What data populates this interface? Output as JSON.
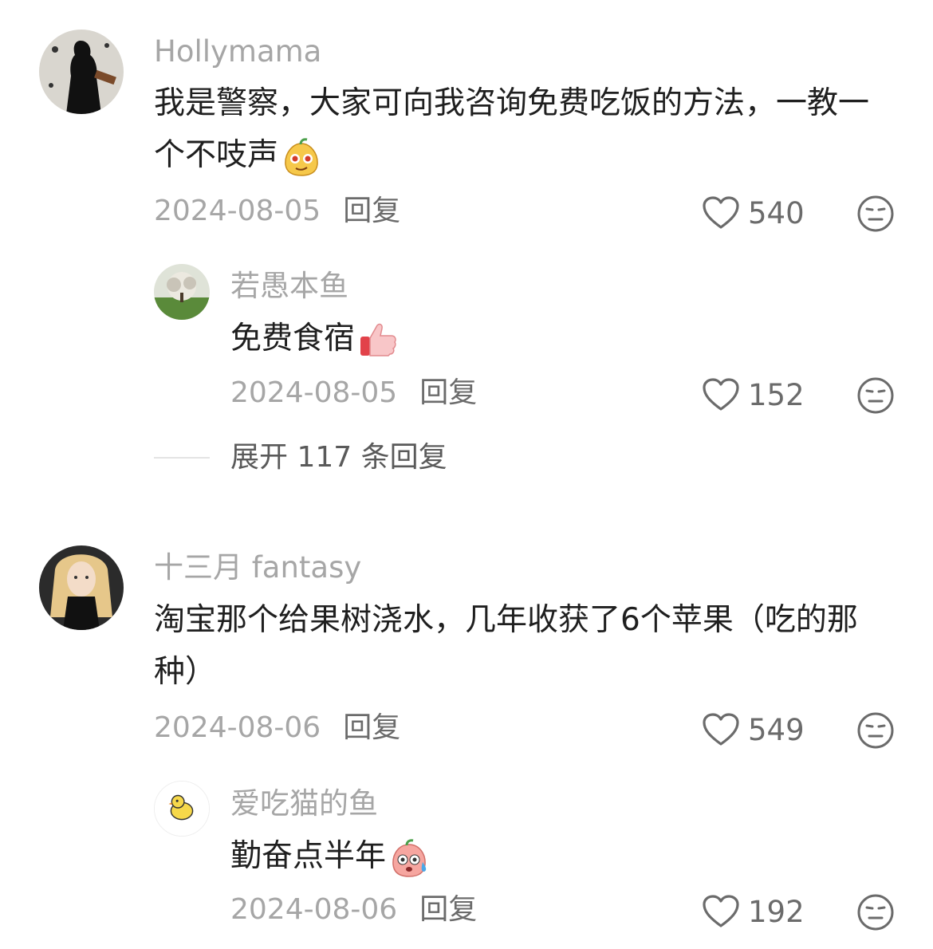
{
  "comments": [
    {
      "username": "Hollymama",
      "text": "我是警察，大家可向我咨询免费吃饭的方法，一教一个不吱声",
      "emoji": "smirking-pear-emoji",
      "date": "2024-08-05",
      "reply_label": "回复",
      "likes": "540",
      "replies": [
        {
          "username": "若愚本鱼",
          "text": "免费食宿",
          "emoji": "thumbs-up-emoji",
          "date": "2024-08-05",
          "reply_label": "回复",
          "likes": "152"
        }
      ],
      "expand_label": "展开 117 条回复"
    },
    {
      "username": "十三月 fantasy",
      "text": "淘宝那个给果树浇水，几年收获了6个苹果（吃的那种）",
      "date": "2024-08-06",
      "reply_label": "回复",
      "likes": "549",
      "replies": [
        {
          "username": "爱吃猫的鱼",
          "text": "勤奋点半年",
          "emoji": "sweating-peach-emoji",
          "date": "2024-08-06",
          "reply_label": "回复",
          "likes": "192"
        }
      ]
    }
  ],
  "icons": {
    "like": "heart-outline-icon",
    "dislike": "neutral-face-icon"
  },
  "colors": {
    "username": "#a6a6a6",
    "text": "#1f1f1f",
    "meta": "#a6a6a6",
    "action": "#6b6b6b"
  }
}
